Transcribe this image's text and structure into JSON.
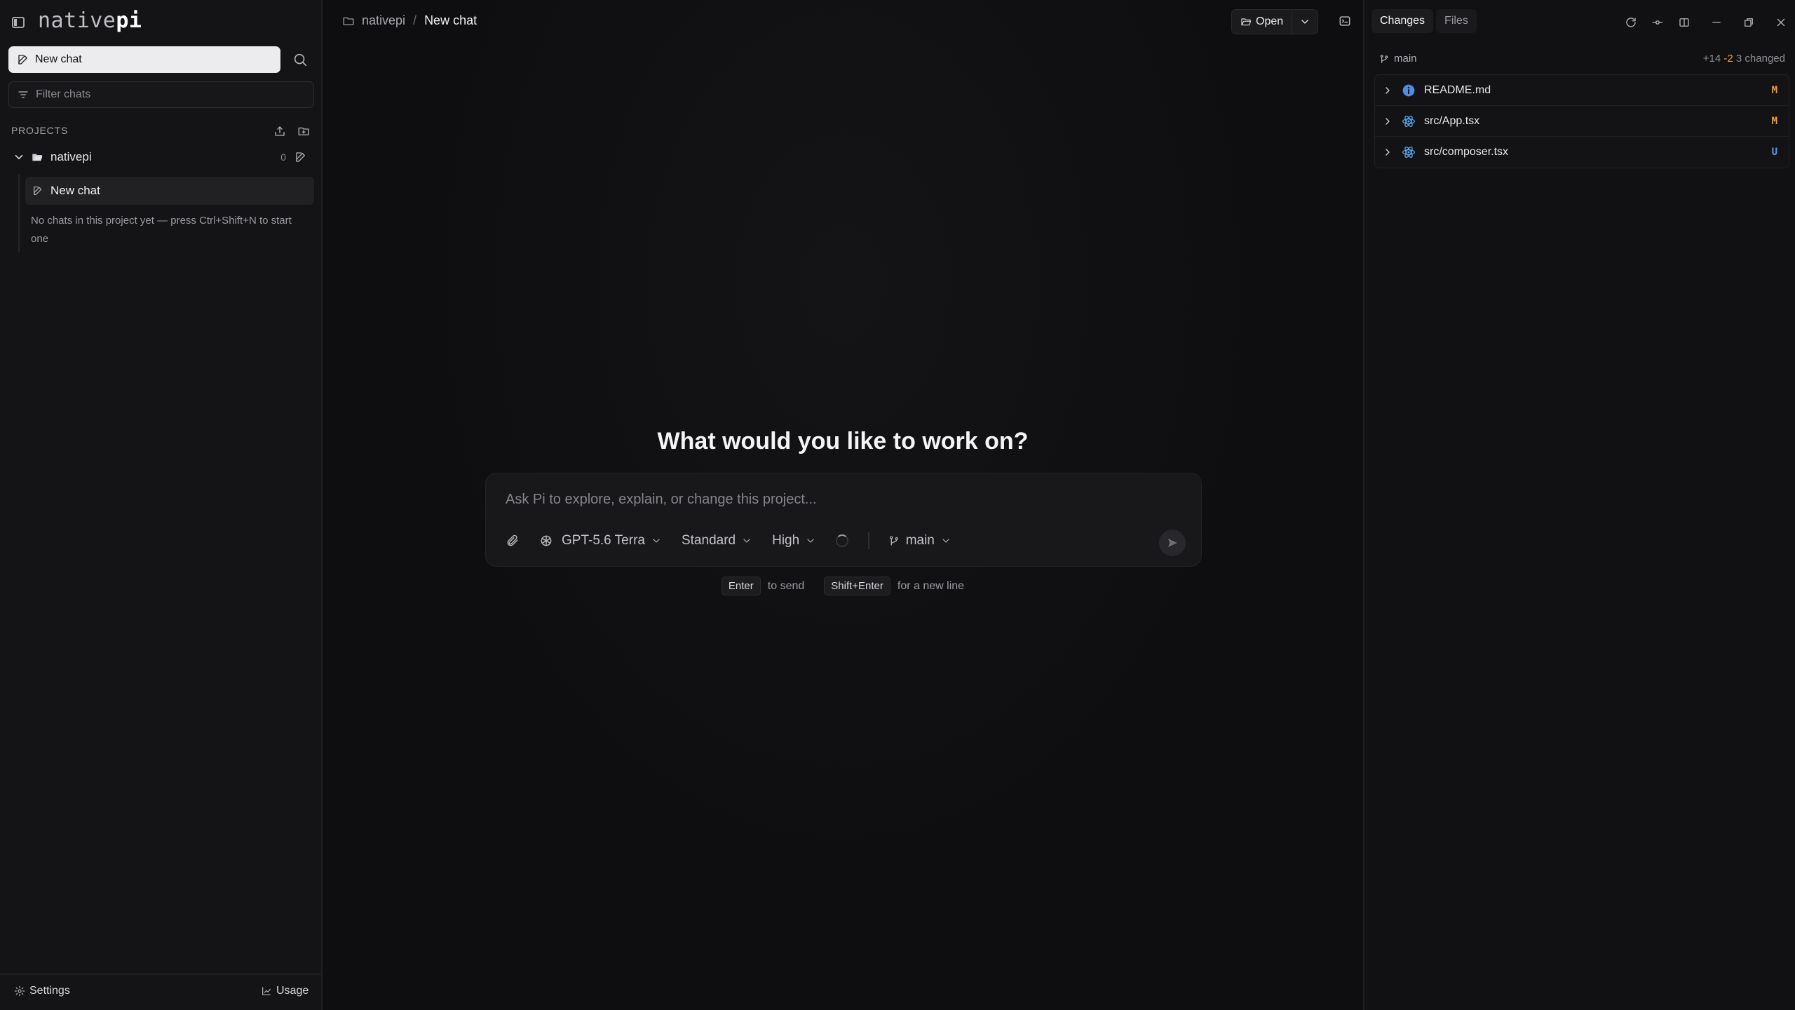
{
  "sidebar": {
    "brand_light": "native",
    "brand_bold": "pi",
    "new_chat_label": "New chat",
    "filter_placeholder": "Filter chats",
    "projects_label": "PROJECTS",
    "project": {
      "name": "nativepi",
      "count": "0",
      "chat_title": "New chat",
      "empty_note": "No chats in this project yet — press Ctrl+Shift+N to start one"
    },
    "footer": {
      "settings_label": "Settings",
      "usage_label": "Usage"
    }
  },
  "main": {
    "breadcrumb": {
      "project": "nativepi",
      "separator": "/",
      "current": "New chat"
    },
    "open_label": "Open",
    "hero_title": "What would you like to work on?",
    "composer": {
      "placeholder": "Ask Pi to explore, explain, or change this project...",
      "model": "GPT-5.6 Terra",
      "mode": "Standard",
      "effort": "High",
      "branch": "main"
    },
    "hints": {
      "send_key": "Enter",
      "send_text": "to send",
      "newline_key": "Shift+Enter",
      "newline_text": "for a new line"
    }
  },
  "right_panel": {
    "tabs": [
      {
        "label": "Changes",
        "active": true
      },
      {
        "label": "Files",
        "active": false
      }
    ],
    "branch": "main",
    "additions": "+14",
    "deletions": "-2",
    "changed_summary": "3 changed",
    "files": [
      {
        "name": "README.md",
        "status": "M",
        "icon": "info-icon",
        "status_color": "#e8a14a"
      },
      {
        "name": "src/App.tsx",
        "status": "M",
        "icon": "react-icon",
        "status_color": "#e8a14a"
      },
      {
        "name": "src/composer.tsx",
        "status": "U",
        "icon": "react-icon",
        "status_color": "#5b9cf0"
      }
    ]
  },
  "colors": {
    "background": "#0e0e10",
    "accent_modified": "#e8a14a",
    "accent_untracked": "#5b9cf0",
    "info_blue": "#4a8fe6"
  }
}
